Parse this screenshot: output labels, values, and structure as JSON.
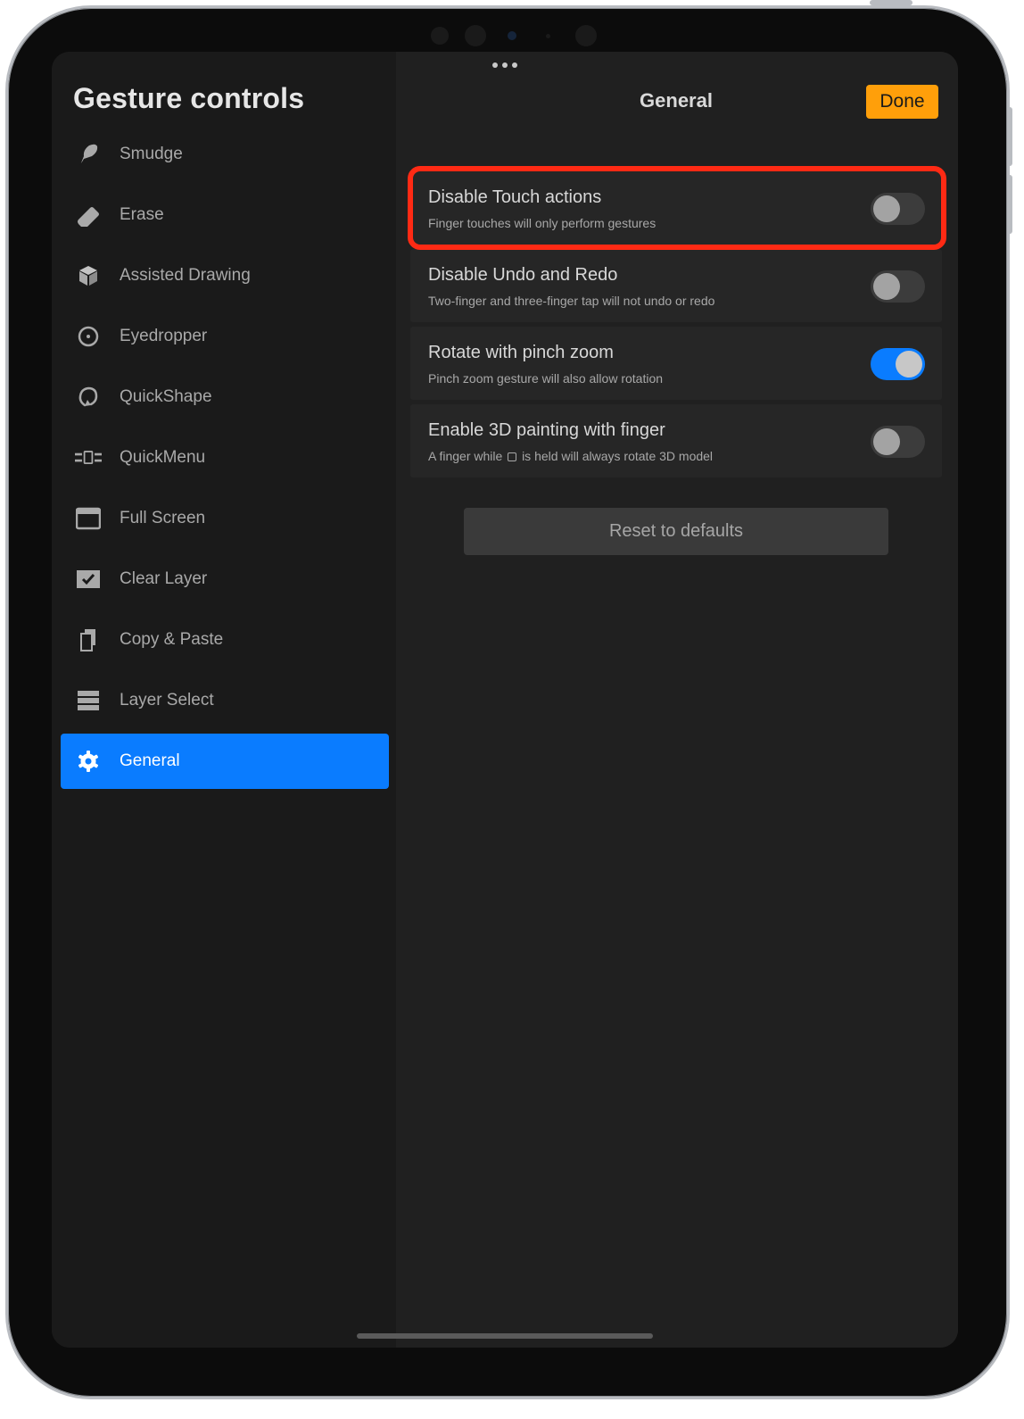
{
  "sidebar": {
    "title": "Gesture controls",
    "items": [
      {
        "label": "Smudge",
        "icon": "smudge-icon",
        "active": false
      },
      {
        "label": "Erase",
        "icon": "eraser-icon",
        "active": false
      },
      {
        "label": "Assisted Drawing",
        "icon": "cube-icon",
        "active": false
      },
      {
        "label": "Eyedropper",
        "icon": "eyedropper-icon",
        "active": false
      },
      {
        "label": "QuickShape",
        "icon": "quickshape-icon",
        "active": false
      },
      {
        "label": "QuickMenu",
        "icon": "quickmenu-icon",
        "active": false
      },
      {
        "label": "Full Screen",
        "icon": "fullscreen-icon",
        "active": false
      },
      {
        "label": "Clear Layer",
        "icon": "checkbox-icon",
        "active": false
      },
      {
        "label": "Copy & Paste",
        "icon": "copy-icon",
        "active": false
      },
      {
        "label": "Layer Select",
        "icon": "layers-icon",
        "active": false
      },
      {
        "label": "General",
        "icon": "gear-icon",
        "active": true
      }
    ]
  },
  "header": {
    "title": "General",
    "done_label": "Done"
  },
  "settings": [
    {
      "title": "Disable Touch actions",
      "subtitle": "Finger touches will only perform gestures",
      "on": false
    },
    {
      "title": "Disable Undo and Redo",
      "subtitle": "Two-finger and three-finger tap will not undo or redo",
      "on": false
    },
    {
      "title": "Rotate with pinch zoom",
      "subtitle": "Pinch zoom gesture will also allow rotation",
      "on": true
    },
    {
      "title": "Enable 3D painting with finger",
      "subtitle_before": "A finger while",
      "subtitle_after": "is held will always rotate 3D model",
      "on": false
    }
  ],
  "reset_label": "Reset to defaults",
  "colors": {
    "accent_blue": "#0a7cff",
    "done_orange": "#ff9f0a",
    "highlight_red": "#ff2a14"
  }
}
